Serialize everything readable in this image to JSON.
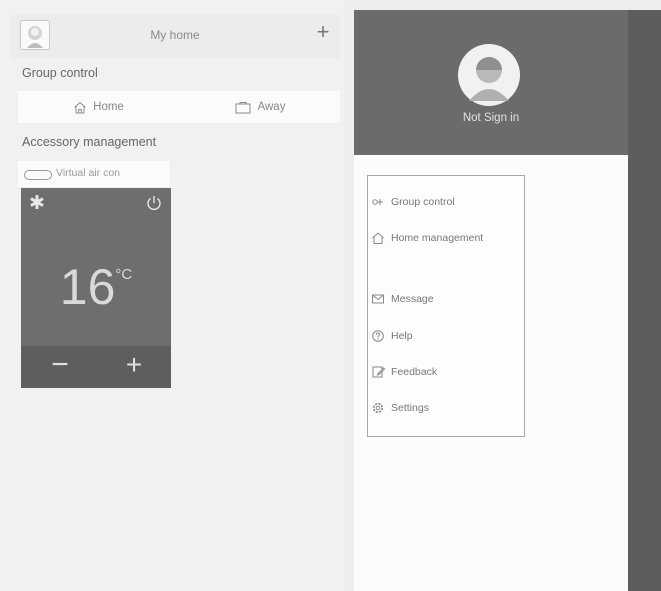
{
  "left": {
    "header": {
      "title": "My home"
    },
    "group_control": {
      "label": "Group control",
      "scenes": [
        {
          "label": "Home"
        },
        {
          "label": "Away"
        }
      ]
    },
    "accessory": {
      "label": "Accessory management",
      "device_name": "Virtual air con",
      "temperature": "16",
      "unit": "°C"
    }
  },
  "right": {
    "header": {
      "sign_in_label": "Not Sign in"
    },
    "menu": [
      {
        "label": "Group control",
        "icon": "group-control-icon"
      },
      {
        "label": "Home management",
        "icon": "home-icon"
      },
      {
        "label": "Message",
        "icon": "message-icon"
      },
      {
        "label": "Help",
        "icon": "help-icon"
      },
      {
        "label": "Feedback",
        "icon": "feedback-icon"
      },
      {
        "label": "Settings",
        "icon": "settings-icon"
      }
    ]
  }
}
